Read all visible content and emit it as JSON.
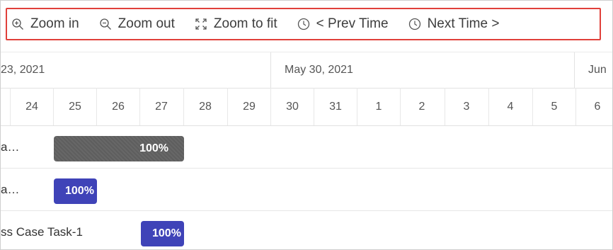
{
  "toolbar": {
    "zoom_in": "Zoom in",
    "zoom_out": "Zoom out",
    "zoom_fit": "Zoom to fit",
    "prev_time": "< Prev Time",
    "next_time": "Next Time >"
  },
  "timeline": {
    "weeks": [
      "23, 2021",
      "May 30, 2021",
      "Jun"
    ],
    "days": [
      "24",
      "25",
      "26",
      "27",
      "28",
      "29",
      "30",
      "31",
      "1",
      "2",
      "3",
      "4",
      "5",
      "6"
    ]
  },
  "rows": [
    {
      "label": "a…",
      "progress": "100%",
      "progress_value": 100
    },
    {
      "label": "a…",
      "progress": "100%",
      "progress_value": 100
    },
    {
      "label": "ss Case Task-1",
      "progress": "100%",
      "progress_value": 100
    }
  ],
  "colors": {
    "toolbar_border": "#e0403a",
    "bar_parent": "#5e5e5e",
    "bar_task": "#3f43b8"
  }
}
